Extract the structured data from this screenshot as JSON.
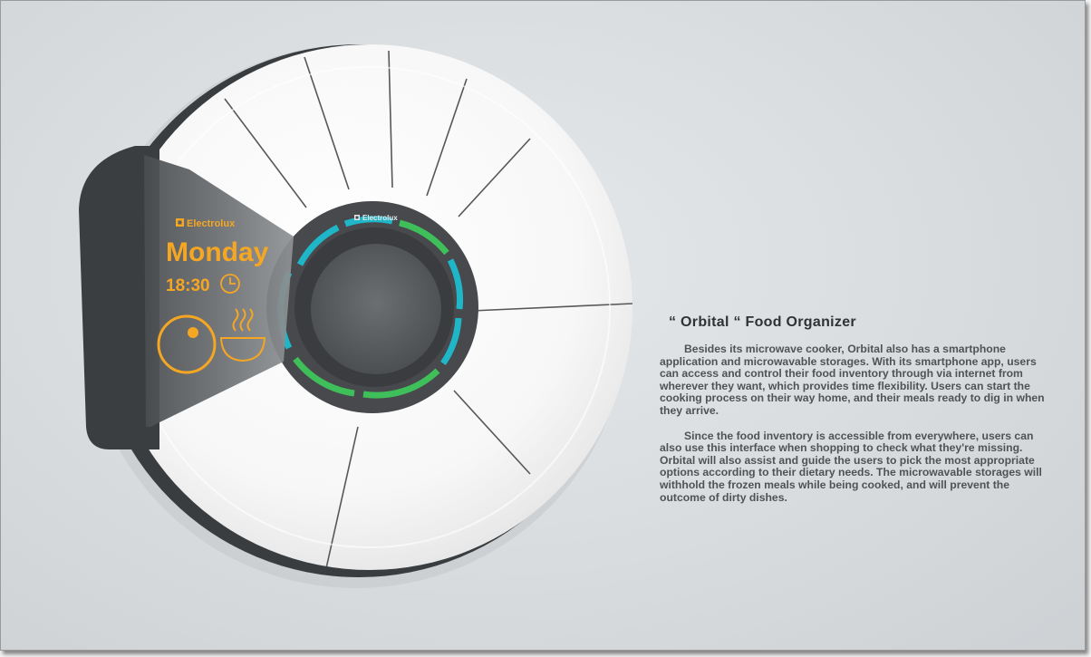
{
  "product": {
    "display": {
      "brand": "Electrolux",
      "day": "Monday",
      "time": "18:30",
      "accent_color": "#f5a623"
    },
    "hub": {
      "brand": "Electrolux",
      "ring_colors": [
        "#1fb6c8",
        "#3fbf5a"
      ]
    },
    "icons": [
      "clock-icon",
      "timer-dial-icon",
      "steaming-bowl-icon",
      "electrolux-logo-icon"
    ]
  },
  "description": {
    "title": "“ Orbital  “ Food Organizer",
    "paragraphs": [
      "Besides its microwave cooker, Orbital also has a smartphone application and microwavable storages. With its smartphone app, users can access and control their food inventory through via internet from wherever they want, which provides time flexibility. Users can start the cooking process on their way home, and their meals ready to dig in when they arrive.",
      "Since the food inventory is accessible from everywhere, users can also use this interface when shopping to check what they're missing. Orbital will also assist and guide the users to pick the most appropriate options according to their dietary needs. The microwavable storages will withhold the frozen meals while being cooked, and will prevent the outcome of dirty dishes."
    ]
  }
}
